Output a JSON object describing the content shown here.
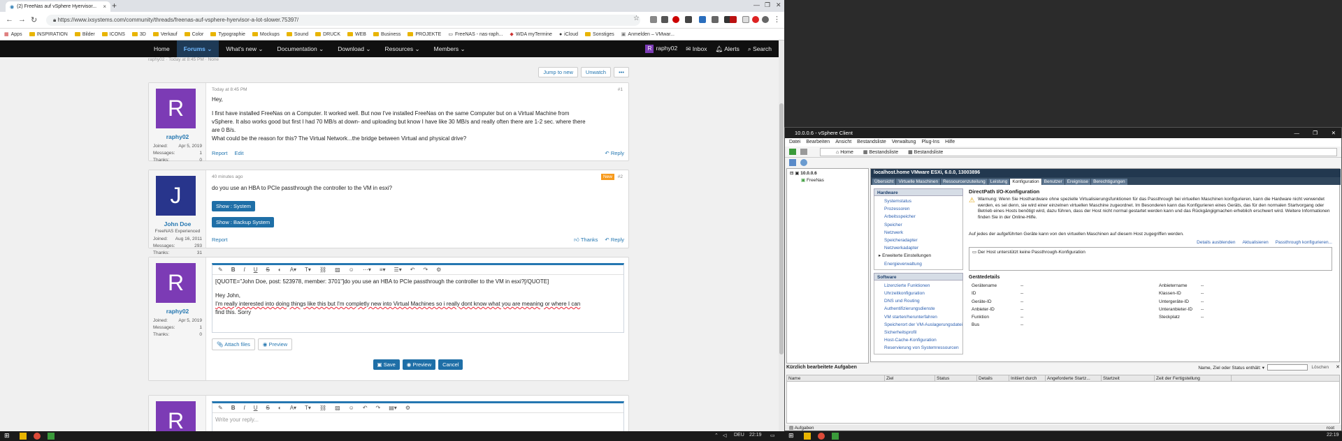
{
  "browser": {
    "tab_title": "(2) FreeNas auf vSphere Hyervisor...",
    "url": "https://www.ixsystems.com/community/threads/freenas-auf-vsphere-hyervisor-a-lot-slower.75397/",
    "bookmarks": [
      "Apps",
      "INSPIRATION",
      "Bilder",
      "ICONS",
      "3D",
      "Verkauf",
      "Color",
      "Typographie",
      "Mockups",
      "Sound",
      "DRUCK",
      "WEB",
      "Business",
      "PROJEKTE",
      "FreeNAS - nas-raph...",
      "WDA myTermine",
      "iCloud",
      "Sonstiges",
      "Anmelden – VMwar..."
    ]
  },
  "site_nav": {
    "items": [
      "Home",
      "Forums",
      "What's new",
      "Documentation",
      "Download",
      "Resources",
      "Members"
    ],
    "user": "raphy02",
    "inbox": "Inbox",
    "alerts": "Alerts",
    "search": "Search"
  },
  "thread": {
    "meta": "raphy02 · Today at 8:45 PM · None",
    "jump_to_new": "Jump to new",
    "unwatch": "Unwatch",
    "more": "•••"
  },
  "posts": [
    {
      "user": "raphy02",
      "avatar_letter": "R",
      "joined_label": "Joined:",
      "joined": "Apr 5, 2019",
      "messages_label": "Messages:",
      "messages": "1",
      "thanks_label": "Thanks:",
      "thanks": "0",
      "time": "Today at 8:45 PM",
      "num": "#1",
      "lines": [
        "Hey,",
        "",
        "I first have installed FreeNas on a Computer. It worked well. But now I've installed FreeNas on the same Computer but on a Virtual Machine from",
        "vSphere. It also works good but first I had 70 MB/s at down- and uploading but know I have like 30 MB/s and really often there are 1-2 sec. where there",
        "are 0 B/s.",
        "What could be the reason for this? The Virtual Network...the bridge between Virtual and physical drive?"
      ],
      "report": "Report",
      "edit": "Edit",
      "reply": "Reply"
    },
    {
      "user": "John Doe",
      "avatar_letter": "J",
      "title": "FreeNAS Experienced",
      "joined_label": "Joined:",
      "joined": "Aug 16, 2011",
      "messages_label": "Messages:",
      "messages": "293",
      "thanks_label": "Thanks:",
      "thanks": "31",
      "time": "40 minutes ago",
      "num": "#2",
      "new_badge": "New",
      "text": "do you use an HBA to PCIe passthrough the controller to the VM in esxi?",
      "show_system": "Show : System",
      "show_backup": "Show : Backup System",
      "report": "Report",
      "thanks_link": "Thanks",
      "reply": "Reply"
    }
  ],
  "reply_editor": {
    "user": "raphy02",
    "avatar_letter": "R",
    "joined_label": "Joined:",
    "joined": "Apr 5, 2019",
    "messages_label": "Messages:",
    "messages": "1",
    "thanks_label": "Thanks:",
    "thanks": "0",
    "quote": "[QUOTE=\"John Doe, post: 523978, member: 3701\"]do you use an HBA to PCIe passthrough the controller to the VM in esxi?[/QUOTE]",
    "line1": "Hey John,",
    "line2": "I'm really interested into doing things like this but I'm completly new into Virtual Machines so i really dont know what you are meaning or where I can",
    "line3": "find this. Sorry",
    "attach": "Attach files",
    "preview": "Preview",
    "save": "Save",
    "preview2": "Preview",
    "cancel": "Cancel",
    "placeholder": "Write your reply..."
  },
  "taskbar": {
    "lang": "DEU",
    "time1": "22:19",
    "time2": "22:19"
  },
  "vsphere": {
    "title": "10.0.0.6 - vSphere Client",
    "menu": [
      "Datei",
      "Bearbeiten",
      "Ansicht",
      "Bestandsliste",
      "Verwaltung",
      "Plug-Ins",
      "Hilfe"
    ],
    "crumb": [
      "Home",
      "Bestandsliste",
      "Bestandsliste"
    ],
    "tree_host": "10.0.0.6",
    "tree_vm": "FreeNas",
    "host_header": "localhost.home VMware ESXi, 6.0.0, 13003896",
    "tabs": [
      "Übersicht",
      "Virtuelle Maschinen",
      "Ressourcenzuteilung",
      "Leistung",
      "Konfiguration",
      "Benutzer",
      "Ereignisse",
      "Berechtigungen"
    ],
    "hardware_label": "Hardware",
    "hardware": [
      "Systemstatus",
      "Prozessoren",
      "Arbeitsspeicher",
      "Speicher",
      "Netzwerk",
      "Speicheradapter",
      "Netzwerkadapter",
      "Erweiterte Einstellungen",
      "Energieverwaltung"
    ],
    "software_label": "Software",
    "software": [
      "Lizenzierte Funktionen",
      "Uhrzeitkonfiguration",
      "DNS und Routing",
      "Authentifizierungsdienste",
      "VM starten/herunterfahren",
      "Speicherort der VM-Auslagerungsdatei",
      "Sicherheitsprofil",
      "Host-Cache-Konfiguration",
      "Reservierung von Systemressourcen"
    ],
    "section_title": "DirectPath I/O-Konfiguration",
    "warning": "Warnung: Wenn Sie Hosthardware ohne spezielle Virtualisierungsfunktionen für das Passthrough bei virtuellen Maschinen konfigurieren, kann die Hardware nicht verwendet werden, es sei denn, sie wird einer einzelnen virtuellen Maschine zugeordnet. Im Besonderen kann das Konfigurieren eines Geräts, das für den normalen Startvorgang oder Betrieb eines Hosts benötigt wird, dazu führen, dass der Host nicht normal gestartet werden kann und das Rückgängigmachen erheblich erschwert wird. Weitere Informationen finden Sie in der Online-Hilfe.",
    "info": "Auf jedes der aufgeführten Geräte kann von den virtuellen Maschinen auf diesem Host zugegriffen werden.",
    "details_hide": "Details ausblenden",
    "refresh": "Aktualisieren",
    "passthrough_config": "Passthrough konfigurieren...",
    "no_passthrough": "Der Host unterstützt keine Passthrough-Konfiguration",
    "device_details": "Gerätedetails",
    "left_fields": [
      "Gerätename",
      "ID",
      "Geräte-ID",
      "Anbieter-ID",
      "Funktion",
      "Bus"
    ],
    "right_fields": [
      "Anbietername",
      "Klassen-ID",
      "Untergeräte-ID",
      "Unteranbieter-ID",
      "Steckplatz"
    ],
    "dash": "--",
    "tasks_title": "Kürzlich bearbeitete Aufgaben",
    "filter_label": "Name, Ziel oder Status enthält: ▾",
    "clear": "Löschen",
    "task_cols": [
      "Name",
      "Ziel",
      "Status",
      "Details",
      "Initiiert durch",
      "Angeforderte Startz...",
      "Startzeit",
      "Zeit der Fertigstellung"
    ],
    "tasks_tab": "Aufgaben",
    "root": "root"
  }
}
